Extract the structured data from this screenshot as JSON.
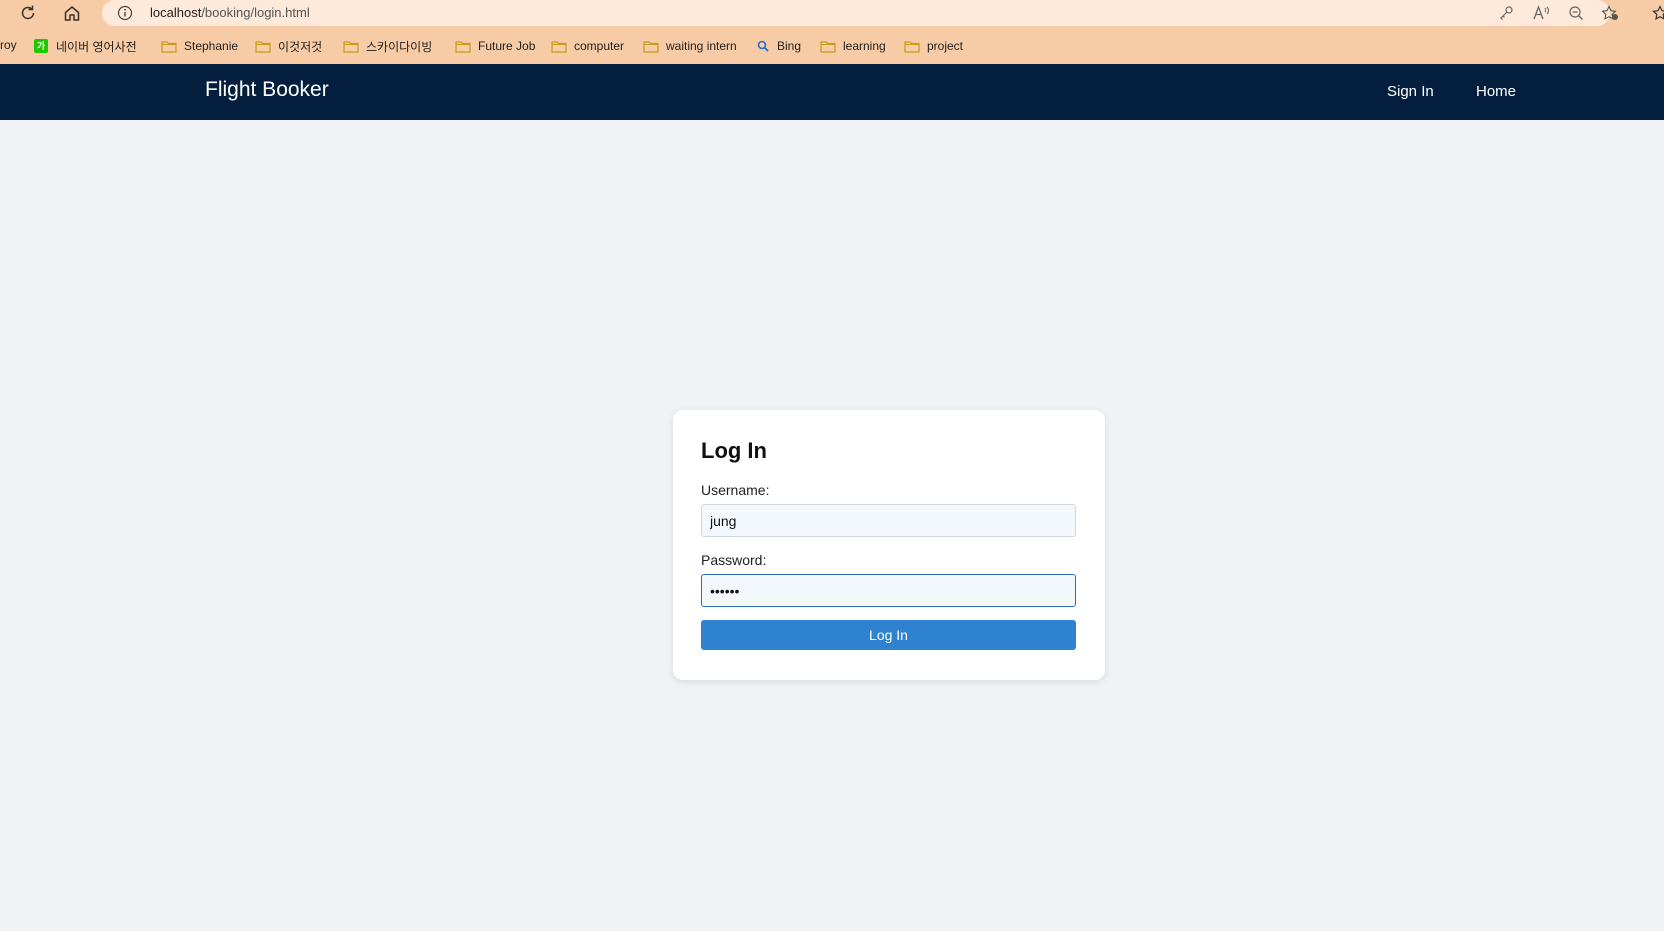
{
  "browser": {
    "url_host": "localhost",
    "url_path": "/booking/login.html"
  },
  "bookmarks": [
    {
      "label": "roy",
      "icon": "truncated-bookmark"
    },
    {
      "label": "네이버 영어사전",
      "icon": "naver-dictionary-icon"
    },
    {
      "label": "Stephanie",
      "icon": "folder-icon"
    },
    {
      "label": "이것저것",
      "icon": "folder-icon"
    },
    {
      "label": "스카이다이빙",
      "icon": "folder-icon"
    },
    {
      "label": "Future Job",
      "icon": "folder-icon"
    },
    {
      "label": "computer",
      "icon": "folder-icon"
    },
    {
      "label": "waiting intern",
      "icon": "folder-icon"
    },
    {
      "label": "Bing",
      "icon": "search-icon"
    },
    {
      "label": "learning",
      "icon": "folder-icon"
    },
    {
      "label": "project",
      "icon": "folder-icon"
    }
  ],
  "header": {
    "brand": "Flight Booker",
    "nav": [
      {
        "label": "Sign In"
      },
      {
        "label": "Home"
      }
    ]
  },
  "login": {
    "title": "Log In",
    "username_label": "Username:",
    "username_value": "jung",
    "password_label": "Password:",
    "password_value": "••••••",
    "submit_label": "Log In"
  },
  "colors": {
    "browser_chrome": "#f7cba5",
    "header_bg": "#041f3d",
    "page_bg": "#f0f2f5",
    "button_bg": "#2f82d0"
  }
}
